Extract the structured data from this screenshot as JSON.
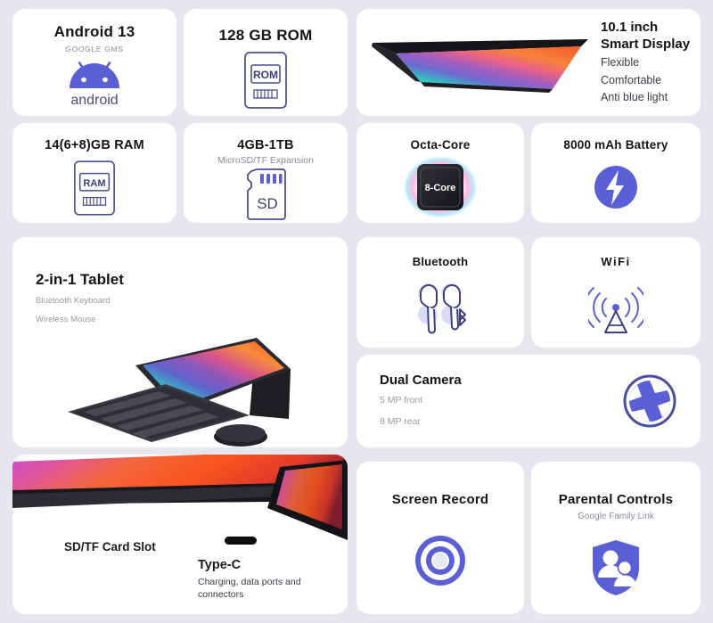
{
  "theme": {
    "background": "#e6e6ef",
    "card": "#ffffff",
    "accent": "#5b5fd6",
    "accent_light": "#7b7fe0",
    "title_color": "#141418",
    "muted_color": "#8b8b99"
  },
  "cards": {
    "android": {
      "title": "Android 13",
      "subtitle": "GOOGLE GMS",
      "icon": "android-robot-icon",
      "logo_text": "android"
    },
    "rom": {
      "title": "128 GB ROM",
      "icon": "rom-module-icon",
      "icon_label": "ROM"
    },
    "display": {
      "heading_line1": "10.1 inch",
      "heading_line2": "Smart Display",
      "features": [
        "Flexible",
        "Comfortable",
        "Anti blue light"
      ],
      "icon": "tablet-display-image"
    },
    "ram": {
      "title": "14(6+8)GB RAM",
      "icon": "ram-module-icon",
      "icon_label": "RAM"
    },
    "sd": {
      "title": "4GB-1TB",
      "subtitle": "MicroSD/TF Expansion",
      "icon": "sd-card-icon",
      "icon_label": "SD"
    },
    "cpu": {
      "title": "Octa-Core",
      "icon": "cpu-chip-icon",
      "chip_label": "8-Core"
    },
    "battery": {
      "title": "8000 mAh Battery",
      "icon": "battery-bolt-icon"
    },
    "tablet": {
      "title": "2-in-1 Tablet",
      "features": [
        "Bluetooth Keyboard",
        "Wireless Mouse"
      ],
      "icon": "tablet-keyboard-mouse-image"
    },
    "bluetooth": {
      "title": "Bluetooth",
      "icon": "earbuds-bluetooth-icon"
    },
    "wifi": {
      "title": "WiFi",
      "icon": "wifi-antenna-icon"
    },
    "camera": {
      "title": "Dual Camera",
      "specs": [
        "5 MP front",
        "8 MP rear"
      ],
      "icon": "camera-aperture-icon"
    },
    "ports": {
      "label_sd": "SD/TF Card Slot",
      "label_typec": "Type-C",
      "label_typec_sub": "Charging, data ports and connectors",
      "icon": "tablet-edge-ports-image"
    },
    "record": {
      "title": "Screen Record",
      "icon": "screen-record-icon"
    },
    "parental": {
      "title": "Parental Controls",
      "subtitle": "Google Family Link",
      "icon": "shield-family-icon"
    }
  }
}
